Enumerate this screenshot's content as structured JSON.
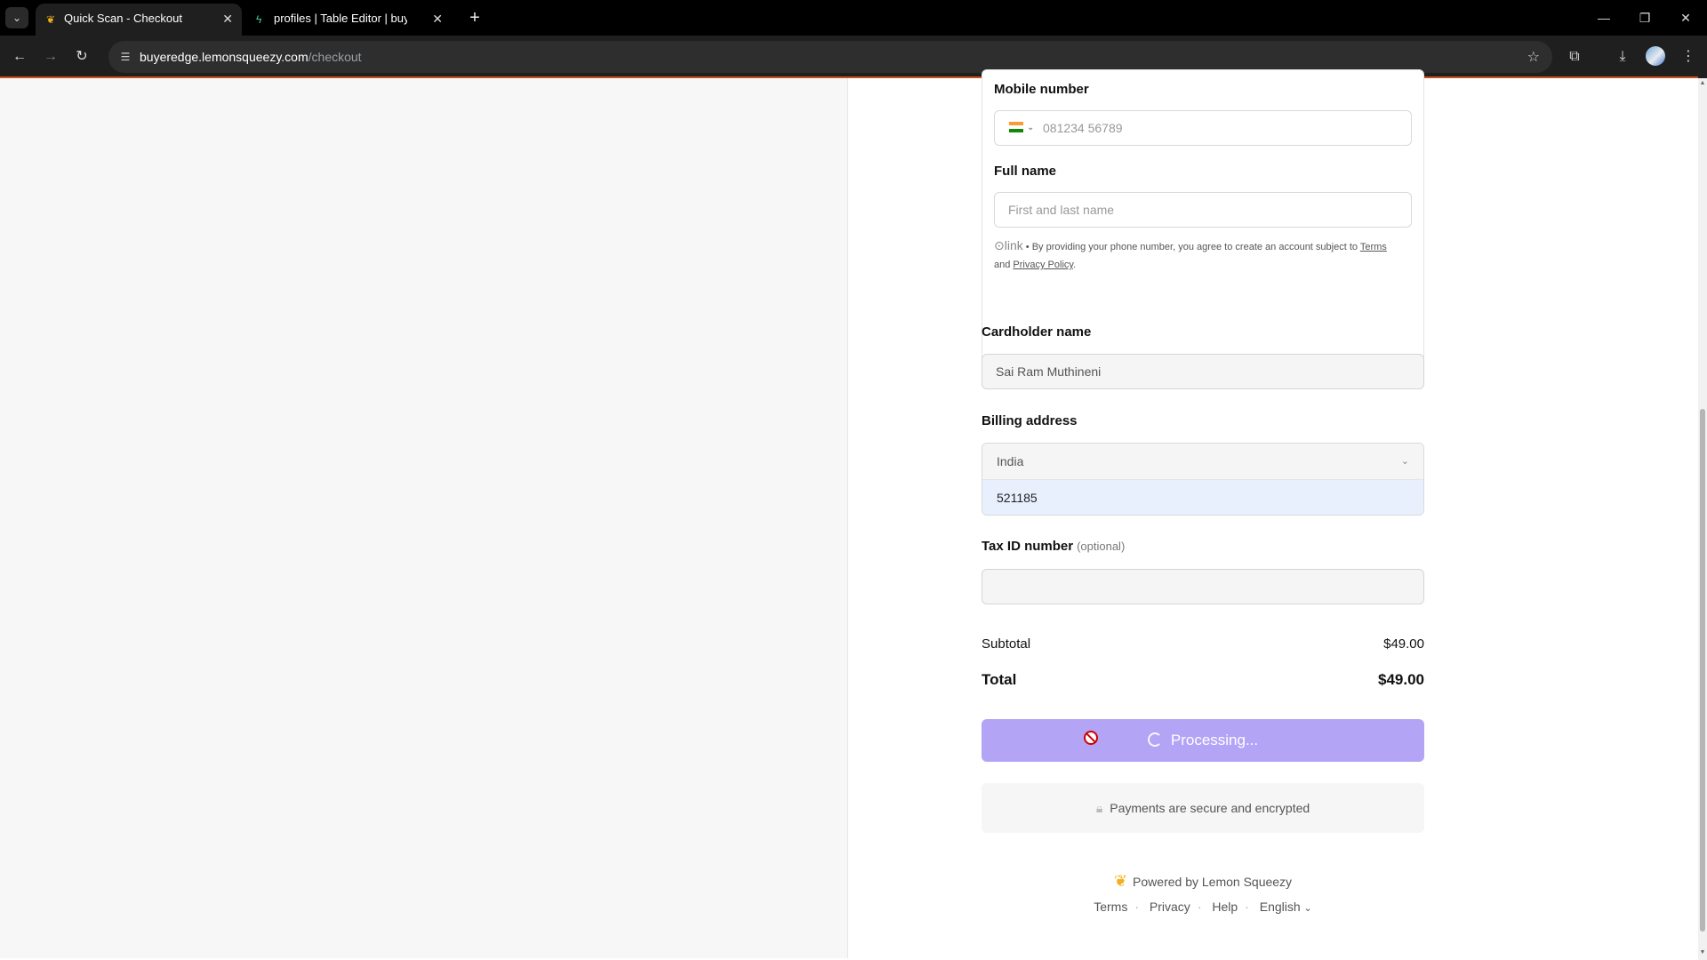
{
  "browser": {
    "tabs": [
      {
        "title": "Quick Scan - Checkout",
        "active": true,
        "favicon": "lemon-icon"
      },
      {
        "title": "profiles | Table Editor | buyeredge",
        "active": false,
        "favicon": "supabase-icon"
      }
    ],
    "url_host": "buyeredge.lemonsqueezy.com",
    "url_path": "/checkout"
  },
  "link_section": {
    "mobile_label": "Mobile number",
    "mobile_placeholder": "081234 56789",
    "fullname_label": "Full name",
    "fullname_placeholder": "First and last name",
    "link_brand": "link",
    "consent_text": " • By providing your phone number, you agree to create an account subject to ",
    "terms": "Terms",
    "and": "and",
    "privacy": "Privacy Policy",
    "period": "."
  },
  "form": {
    "cardholder_label": "Cardholder name",
    "cardholder_value": "Sai Ram Muthineni",
    "billing_label": "Billing address",
    "country": "India",
    "postal_code": "521185",
    "tax_label": "Tax ID number",
    "tax_optional": "(optional)",
    "tax_value": ""
  },
  "summary": {
    "subtotal_label": "Subtotal",
    "subtotal_value": "$49.00",
    "total_label": "Total",
    "total_value": "$49.00"
  },
  "pay_button": {
    "label": "Processing..."
  },
  "secure_note": "Payments are secure and encrypted",
  "footer": {
    "powered": "Powered by Lemon Squeezy",
    "links": [
      "Terms",
      "Privacy",
      "Help"
    ],
    "language": "English"
  },
  "colors": {
    "accent_line": "#c9511f",
    "pay_button": "#b3a4f6",
    "selected_row": "#e8f0fe"
  }
}
